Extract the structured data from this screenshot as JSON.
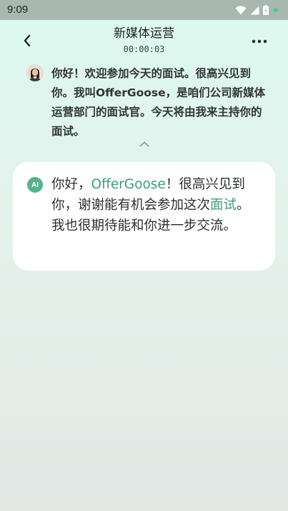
{
  "status_bar": {
    "time": "9:09",
    "icons": [
      "wifi-icon",
      "signal-icon",
      "battery-icon",
      "notification-dot"
    ],
    "accent": "#3ccf8e"
  },
  "header": {
    "title": "新媒体运营",
    "timer": "00:00:03",
    "back_icon": "chevron-left-icon",
    "more_icon": "more-horizontal-icon"
  },
  "interviewer": {
    "message": "你好！欢迎参加今天的面试。很高兴见到你。我叫OfferGoose，是咱们公司新媒体运营部门的面试官。今天将由我来主持你的面试。"
  },
  "answer": {
    "badge": "AI",
    "segments": {
      "s1": "你好，",
      "s2": "OfferGoose",
      "s3": "！很高兴见到你，谢谢能有机会参加这次",
      "s4": "面试",
      "s5": "。我也很期待能和你进一步交流。"
    },
    "highlight_color": "#3d9d78",
    "badge_color": "#55b38a"
  }
}
